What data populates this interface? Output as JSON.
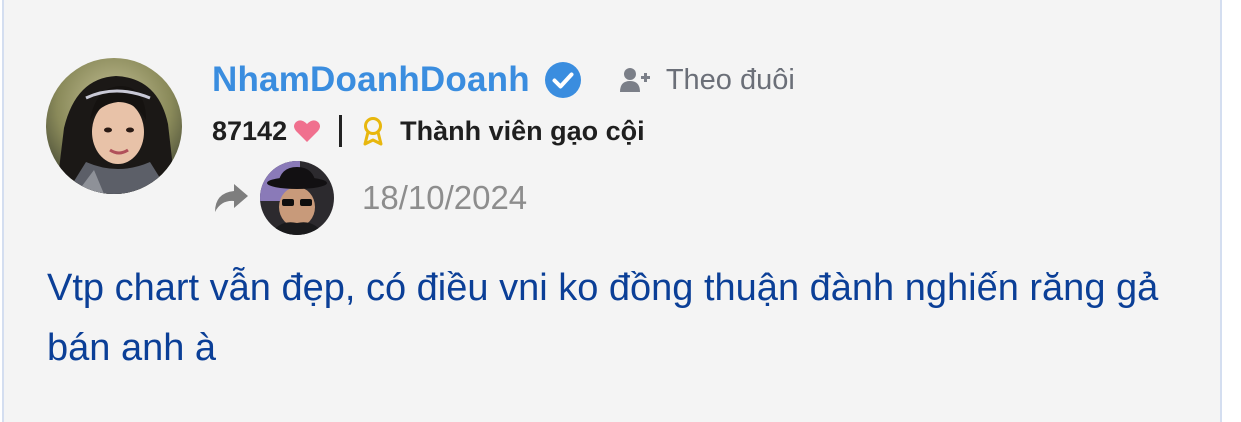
{
  "post": {
    "author": {
      "username": "NhamDoanhDoanh",
      "verified": true,
      "follow_label": "Theo đuôi",
      "points": "87142",
      "rank": "Thành viên gạo cội"
    },
    "date": "18/10/2024",
    "content": "Vtp chart vẫn đẹp, có điều vni ko đồng thuận đành nghiến răng gả bán anh à"
  },
  "icons": {
    "verified": "verified-check-icon",
    "follow": "user-plus-icon",
    "like": "heart-icon",
    "rank": "award-ribbon-icon",
    "share": "share-arrow-icon"
  },
  "colors": {
    "username": "#3a8ddf",
    "verified_badge": "#3a8ddf",
    "heart": "#f0708e",
    "award": "#e8b70d",
    "content_text": "#0b3f97",
    "date_text": "#8d8d8d",
    "card_background": "#f4f4f4"
  }
}
